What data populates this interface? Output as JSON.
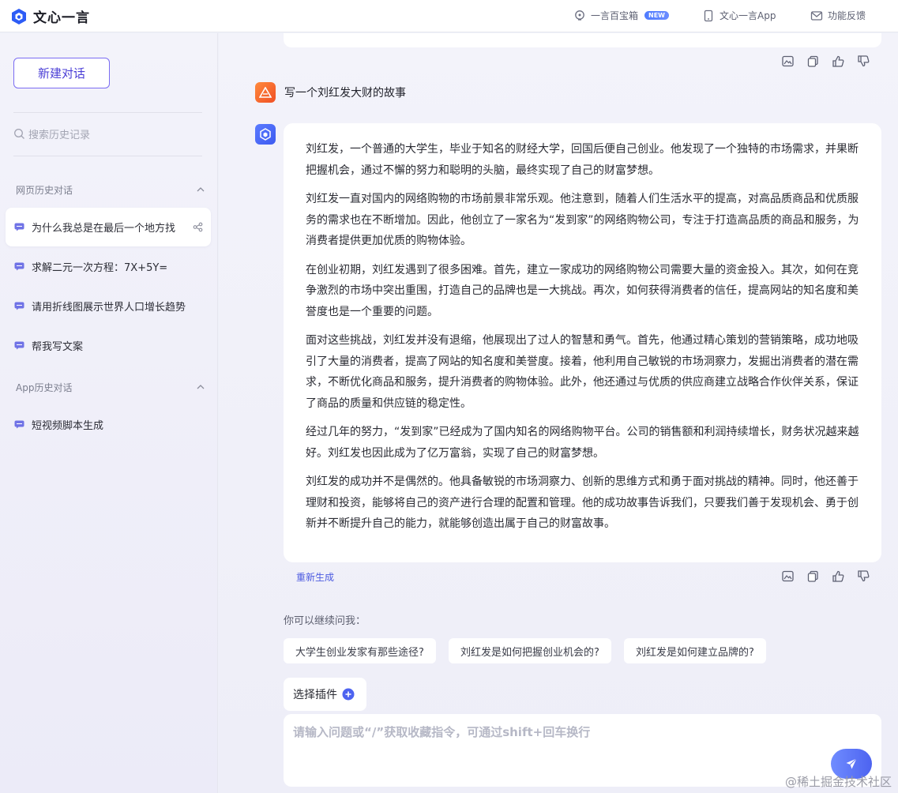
{
  "app": {
    "name": "文心一言"
  },
  "header": {
    "treasure_label": "一言百宝箱",
    "new_badge": "NEW",
    "app_label": "文心一言App",
    "feedback_label": "功能反馈"
  },
  "sidebar": {
    "new_chat_label": "新建对话",
    "search_placeholder": "搜索历史记录",
    "web_section_title": "网页历史对话",
    "web_items": [
      {
        "label": "为什么我总是在最后一个地方找"
      },
      {
        "label": "求解二元一次方程：7X+5Y="
      },
      {
        "label": "请用折线图展示世界人口增长趋势"
      },
      {
        "label": "帮我写文案"
      }
    ],
    "app_section_title": "App历史对话",
    "app_items": [
      {
        "label": "短视频脚本生成"
      }
    ]
  },
  "conversation": {
    "user_message": "写一个刘红发大财的故事",
    "answer_paragraphs": [
      "刘红发，一个普通的大学生，毕业于知名的财经大学，回国后便自己创业。他发现了一个独特的市场需求，并果断把握机会，通过不懈的努力和聪明的头脑，最终实现了自己的财富梦想。",
      "刘红发一直对国内的网络购物的市场前景非常乐观。他注意到，随着人们生活水平的提高，对高品质商品和优质服务的需求也在不断增加。因此，他创立了一家名为“发到家”的网络购物公司，专注于打造高品质的商品和服务，为消费者提供更加优质的购物体验。",
      "在创业初期，刘红发遇到了很多困难。首先，建立一家成功的网络购物公司需要大量的资金投入。其次，如何在竞争激烈的市场中突出重围，打造自己的品牌也是一大挑战。再次，如何获得消费者的信任，提高网站的知名度和美誉度也是一个重要的问题。",
      "面对这些挑战，刘红发并没有退缩，他展现出了过人的智慧和勇气。首先，他通过精心策划的营销策略，成功地吸引了大量的消费者，提高了网站的知名度和美誉度。接着，他利用自己敏锐的市场洞察力，发掘出消费者的潜在需求，不断优化商品和服务，提升消费者的购物体验。此外，他还通过与优质的供应商建立战略合作伙伴关系，保证了商品的质量和供应链的稳定性。",
      "经过几年的努力，“发到家”已经成为了国内知名的网络购物平台。公司的销售额和利润持续增长，财务状况越来越好。刘红发也因此成为了亿万富翁，实现了自己的财富梦想。",
      "刘红发的成功并不是偶然的。他具备敏锐的市场洞察力、创新的思维方式和勇于面对挑战的精神。同时，他还善于理财和投资，能够将自己的资产进行合理的配置和管理。他的成功故事告诉我们，只要我们善于发现机会、勇于创新并不断提升自己的能力，就能够创造出属于自己的财富故事。"
    ],
    "regenerate_label": "重新生成"
  },
  "suggestions": {
    "title": "你可以继续问我：",
    "items": [
      {
        "label": "大学生创业发家有那些途径?"
      },
      {
        "label": "刘红发是如何把握创业机会的?"
      },
      {
        "label": "刘红发是如何建立品牌的?"
      }
    ]
  },
  "composer": {
    "plugin_label": "选择插件",
    "placeholder": "请输入问题或“/”获取收藏指令，可通过shift+回车换行"
  },
  "watermark": "@稀土掘金技术社区",
  "colors": {
    "accent": "#4d63f0",
    "accent_purple": "#7b6cf2",
    "user_avatar": "#f04f24"
  }
}
